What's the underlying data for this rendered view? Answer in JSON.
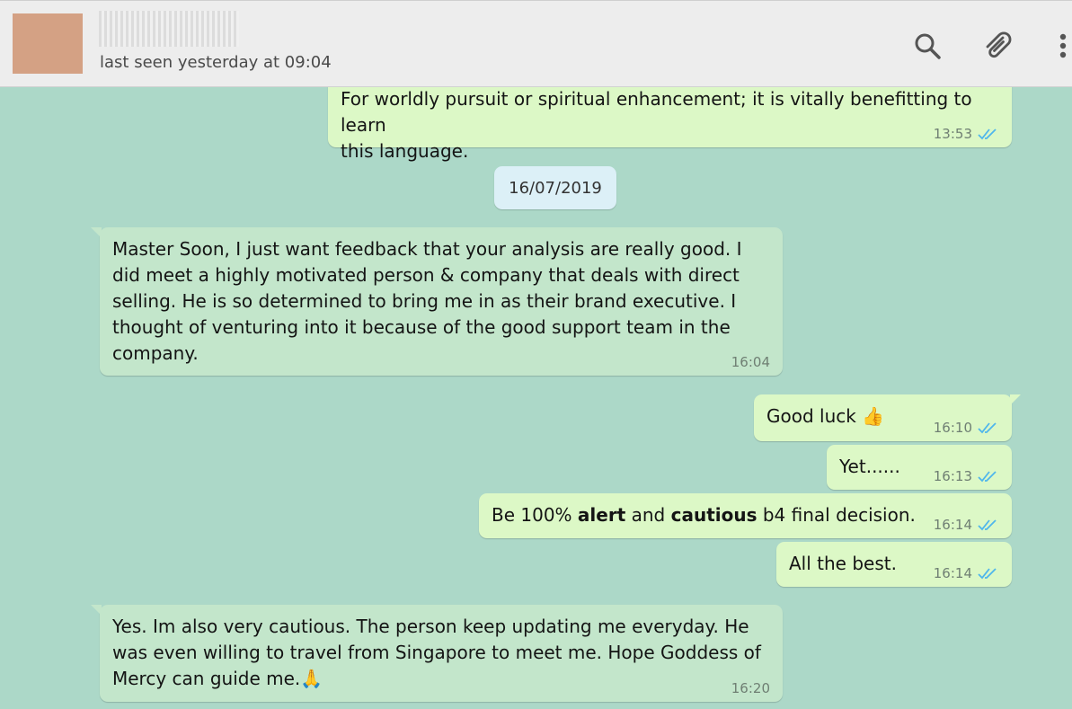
{
  "header": {
    "last_seen": "last seen yesterday at 09:04"
  },
  "date_separator": "16/07/2019",
  "messages": [
    {
      "line1": "For worldly pursuit or spiritual enhancement; it is vitally benefitting to learn",
      "line2": "this language.",
      "time": "13:53"
    },
    {
      "text": "Master Soon, I just want feedback that your analysis are really good. I did meet a highly motivated person & company that deals with direct selling. He is so determined to bring me in as their brand executive. I thought of venturing into it because of the good support team in the company.",
      "time": "16:04"
    },
    {
      "text": "Good luck 👍",
      "time": "16:10"
    },
    {
      "text": "Yet......",
      "time": "16:13"
    },
    {
      "parts": [
        "Be 100% ",
        "alert",
        " and ",
        "cautious",
        " b4 final decision."
      ],
      "time": "16:14"
    },
    {
      "text": "All the best.",
      "time": "16:14"
    },
    {
      "text": "Yes. Im also very cautious. The person keep updating me everyday. He was even willing to travel from Singapore to meet me. Hope Goddess of Mercy can guide me.🙏",
      "time": "16:20"
    }
  ],
  "colors": {
    "chat_background": "#acd8c8",
    "outgoing_bubble": "#dcf8c6",
    "incoming_bubble": "#c3e6cb",
    "read_ticks": "#4fb6ec"
  },
  "icons": [
    "search-icon",
    "attach-icon",
    "menu-icon",
    "double-check-icon"
  ]
}
